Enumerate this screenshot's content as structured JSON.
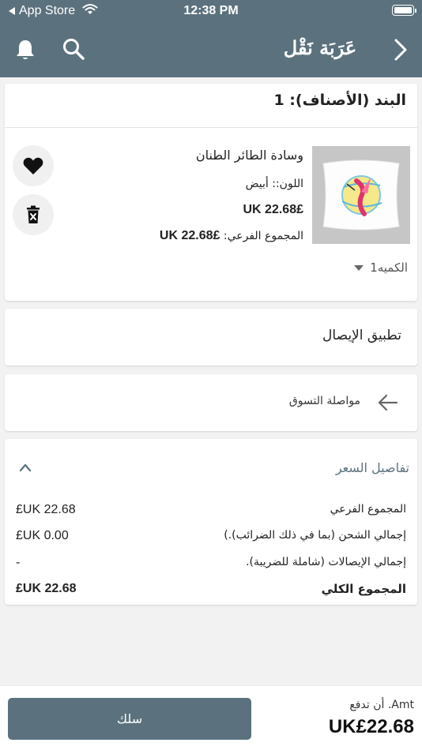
{
  "status_bar": {
    "back_app": "App Store",
    "time": "12:38 PM"
  },
  "nav": {
    "logo_text": "عَرَبَة نَقْل",
    "logo_color": "#ffffff",
    "brand_color": "#5b727e",
    "icons": [
      "bell-icon",
      "search-icon",
      "chevron-right-icon"
    ]
  },
  "cart": {
    "items_header": "البند (الأصناف): 1",
    "item": {
      "name": "وسادة الطائر الطنان",
      "color": "اللون:: أبيض",
      "price": "£UK 22.68",
      "subtotal_label": "المجموع الفرعي:",
      "subtotal_value": "£UK 22.68",
      "quantity": "الكميه1"
    }
  },
  "voucher": {
    "label": "تطبيق الإيصال"
  },
  "continue_shopping": {
    "label": "مواصلة التسوق"
  },
  "price_details": {
    "title": "تفاصيل السعر",
    "rows": [
      {
        "label": "المجموع الفرعي",
        "value": "£UK 22.68"
      },
      {
        "label": "إجمالي الشحن (بما في ذلك الضرائب).)",
        "value": "£UK 0.00"
      },
      {
        "label": "إجمالي الإيصالات (شاملة للضريبة).",
        "value": "-"
      },
      {
        "label": "المجموع الكلي",
        "value": "£UK 22.68"
      }
    ]
  },
  "bottom": {
    "checkout_label": "سلك",
    "amt_label": "Amt. أن تدفع",
    "amt_value": "UK£22.68"
  }
}
